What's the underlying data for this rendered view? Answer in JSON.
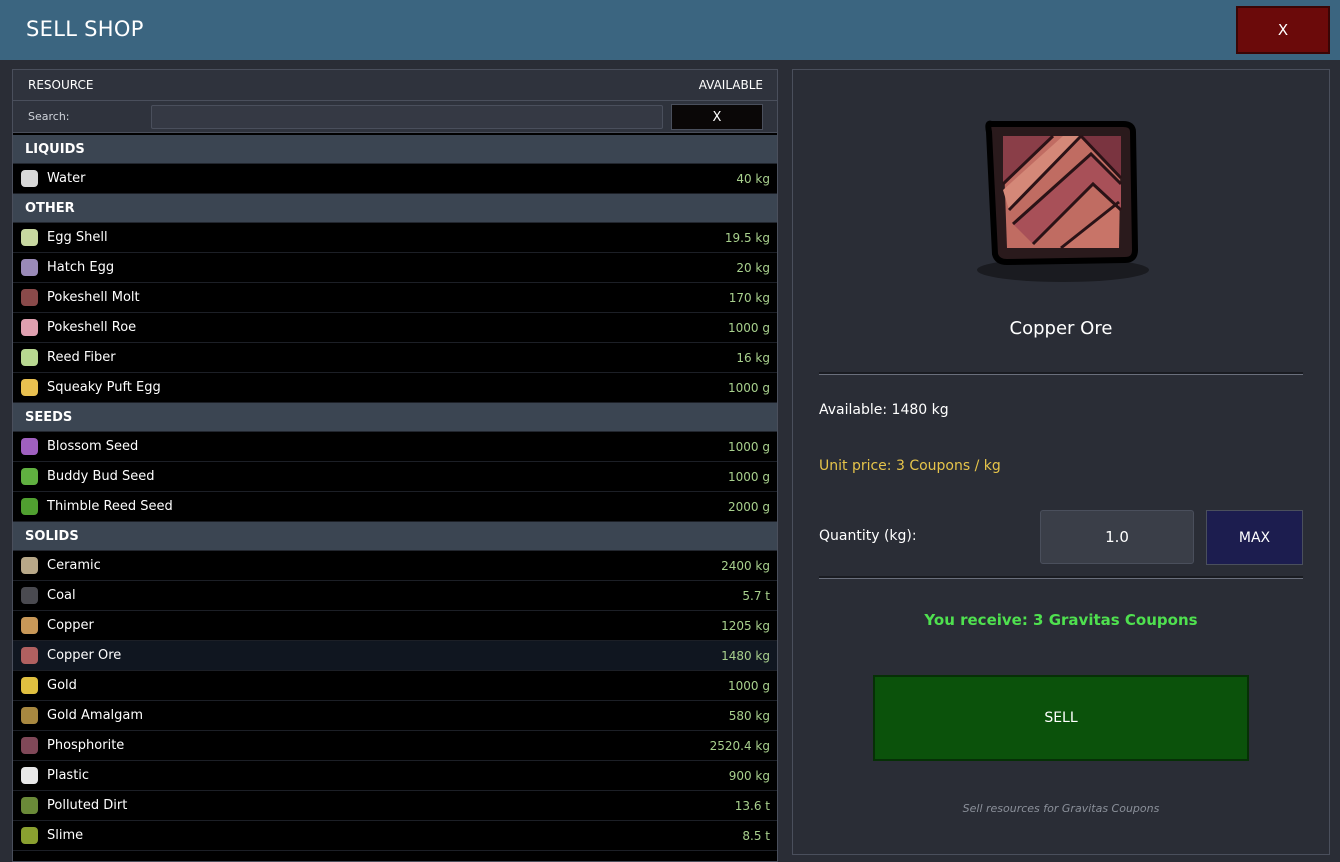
{
  "title": "SELL SHOP",
  "close_label": "X",
  "table": {
    "resource_header": "RESOURCE",
    "available_header": "AVAILABLE",
    "search_label": "Search:",
    "search_value": "",
    "search_clear_label": "X"
  },
  "categories": [
    {
      "name": "LIQUIDS",
      "items": [
        {
          "name": "Water",
          "amount": "40 kg",
          "icon": "water-bottle-icon",
          "color": "#d8d8d8"
        }
      ]
    },
    {
      "name": "OTHER",
      "items": [
        {
          "name": "Egg Shell",
          "amount": "19.5 kg",
          "icon": "egg-shell-icon",
          "color": "#c8d8a0"
        },
        {
          "name": "Hatch Egg",
          "amount": "20 kg",
          "icon": "hatch-egg-icon",
          "color": "#9a8ab8"
        },
        {
          "name": "Pokeshell Molt",
          "amount": "170 kg",
          "icon": "pokeshell-molt-icon",
          "color": "#8a4a4a"
        },
        {
          "name": "Pokeshell Roe",
          "amount": "1000 g",
          "icon": "pokeshell-roe-icon",
          "color": "#e0a0b0"
        },
        {
          "name": "Reed Fiber",
          "amount": "16 kg",
          "icon": "reed-fiber-icon",
          "color": "#b8d890"
        },
        {
          "name": "Squeaky Puft Egg",
          "amount": "1000 g",
          "icon": "squeaky-puft-egg-icon",
          "color": "#e8c050"
        }
      ]
    },
    {
      "name": "SEEDS",
      "items": [
        {
          "name": "Blossom Seed",
          "amount": "1000 g",
          "icon": "blossom-seed-icon",
          "color": "#a060c0"
        },
        {
          "name": "Buddy Bud Seed",
          "amount": "1000 g",
          "icon": "buddy-bud-seed-icon",
          "color": "#60b040"
        },
        {
          "name": "Thimble Reed Seed",
          "amount": "2000 g",
          "icon": "thimble-reed-seed-icon",
          "color": "#50a030"
        }
      ]
    },
    {
      "name": "SOLIDS",
      "items": [
        {
          "name": "Ceramic",
          "amount": "2400 kg",
          "icon": "ceramic-icon",
          "color": "#b8a888"
        },
        {
          "name": "Coal",
          "amount": "5.7 t",
          "icon": "coal-icon",
          "color": "#4a4a50"
        },
        {
          "name": "Copper",
          "amount": "1205 kg",
          "icon": "copper-icon",
          "color": "#c89858"
        },
        {
          "name": "Copper Ore",
          "amount": "1480 kg",
          "icon": "copper-ore-icon",
          "color": "#b06060",
          "selected": true
        },
        {
          "name": "Gold",
          "amount": "1000 g",
          "icon": "gold-icon",
          "color": "#e0c040"
        },
        {
          "name": "Gold Amalgam",
          "amount": "580 kg",
          "icon": "gold-amalgam-icon",
          "color": "#a88840"
        },
        {
          "name": "Phosphorite",
          "amount": "2520.4 kg",
          "icon": "phosphorite-icon",
          "color": "#804858"
        },
        {
          "name": "Plastic",
          "amount": "900 kg",
          "icon": "plastic-icon",
          "color": "#e8e8e8"
        },
        {
          "name": "Polluted Dirt",
          "amount": "13.6 t",
          "icon": "polluted-dirt-icon",
          "color": "#6a8a38"
        },
        {
          "name": "Slime",
          "amount": "8.5 t",
          "icon": "slime-icon",
          "color": "#8aa030"
        }
      ]
    }
  ],
  "detail": {
    "name": "Copper Ore",
    "image_icon": "copper-ore-icon",
    "available": "Available: 1480 kg",
    "unit_price": "Unit price: 3 Coupons / kg",
    "quantity_label": "Quantity (kg):",
    "quantity_value": "1.0",
    "max_label": "MAX",
    "receive": "You receive: 3 Gravitas Coupons",
    "sell_label": "SELL",
    "footer": "Sell resources for Gravitas Coupons"
  },
  "colors": {
    "titlebar": "#3b6580",
    "close": "#6b0a0a",
    "sell": "#0b520b",
    "max": "#1c1d4f",
    "price_text": "#e6c44a",
    "receive_text": "#4fe04f",
    "amount_text": "#a8d08d"
  }
}
